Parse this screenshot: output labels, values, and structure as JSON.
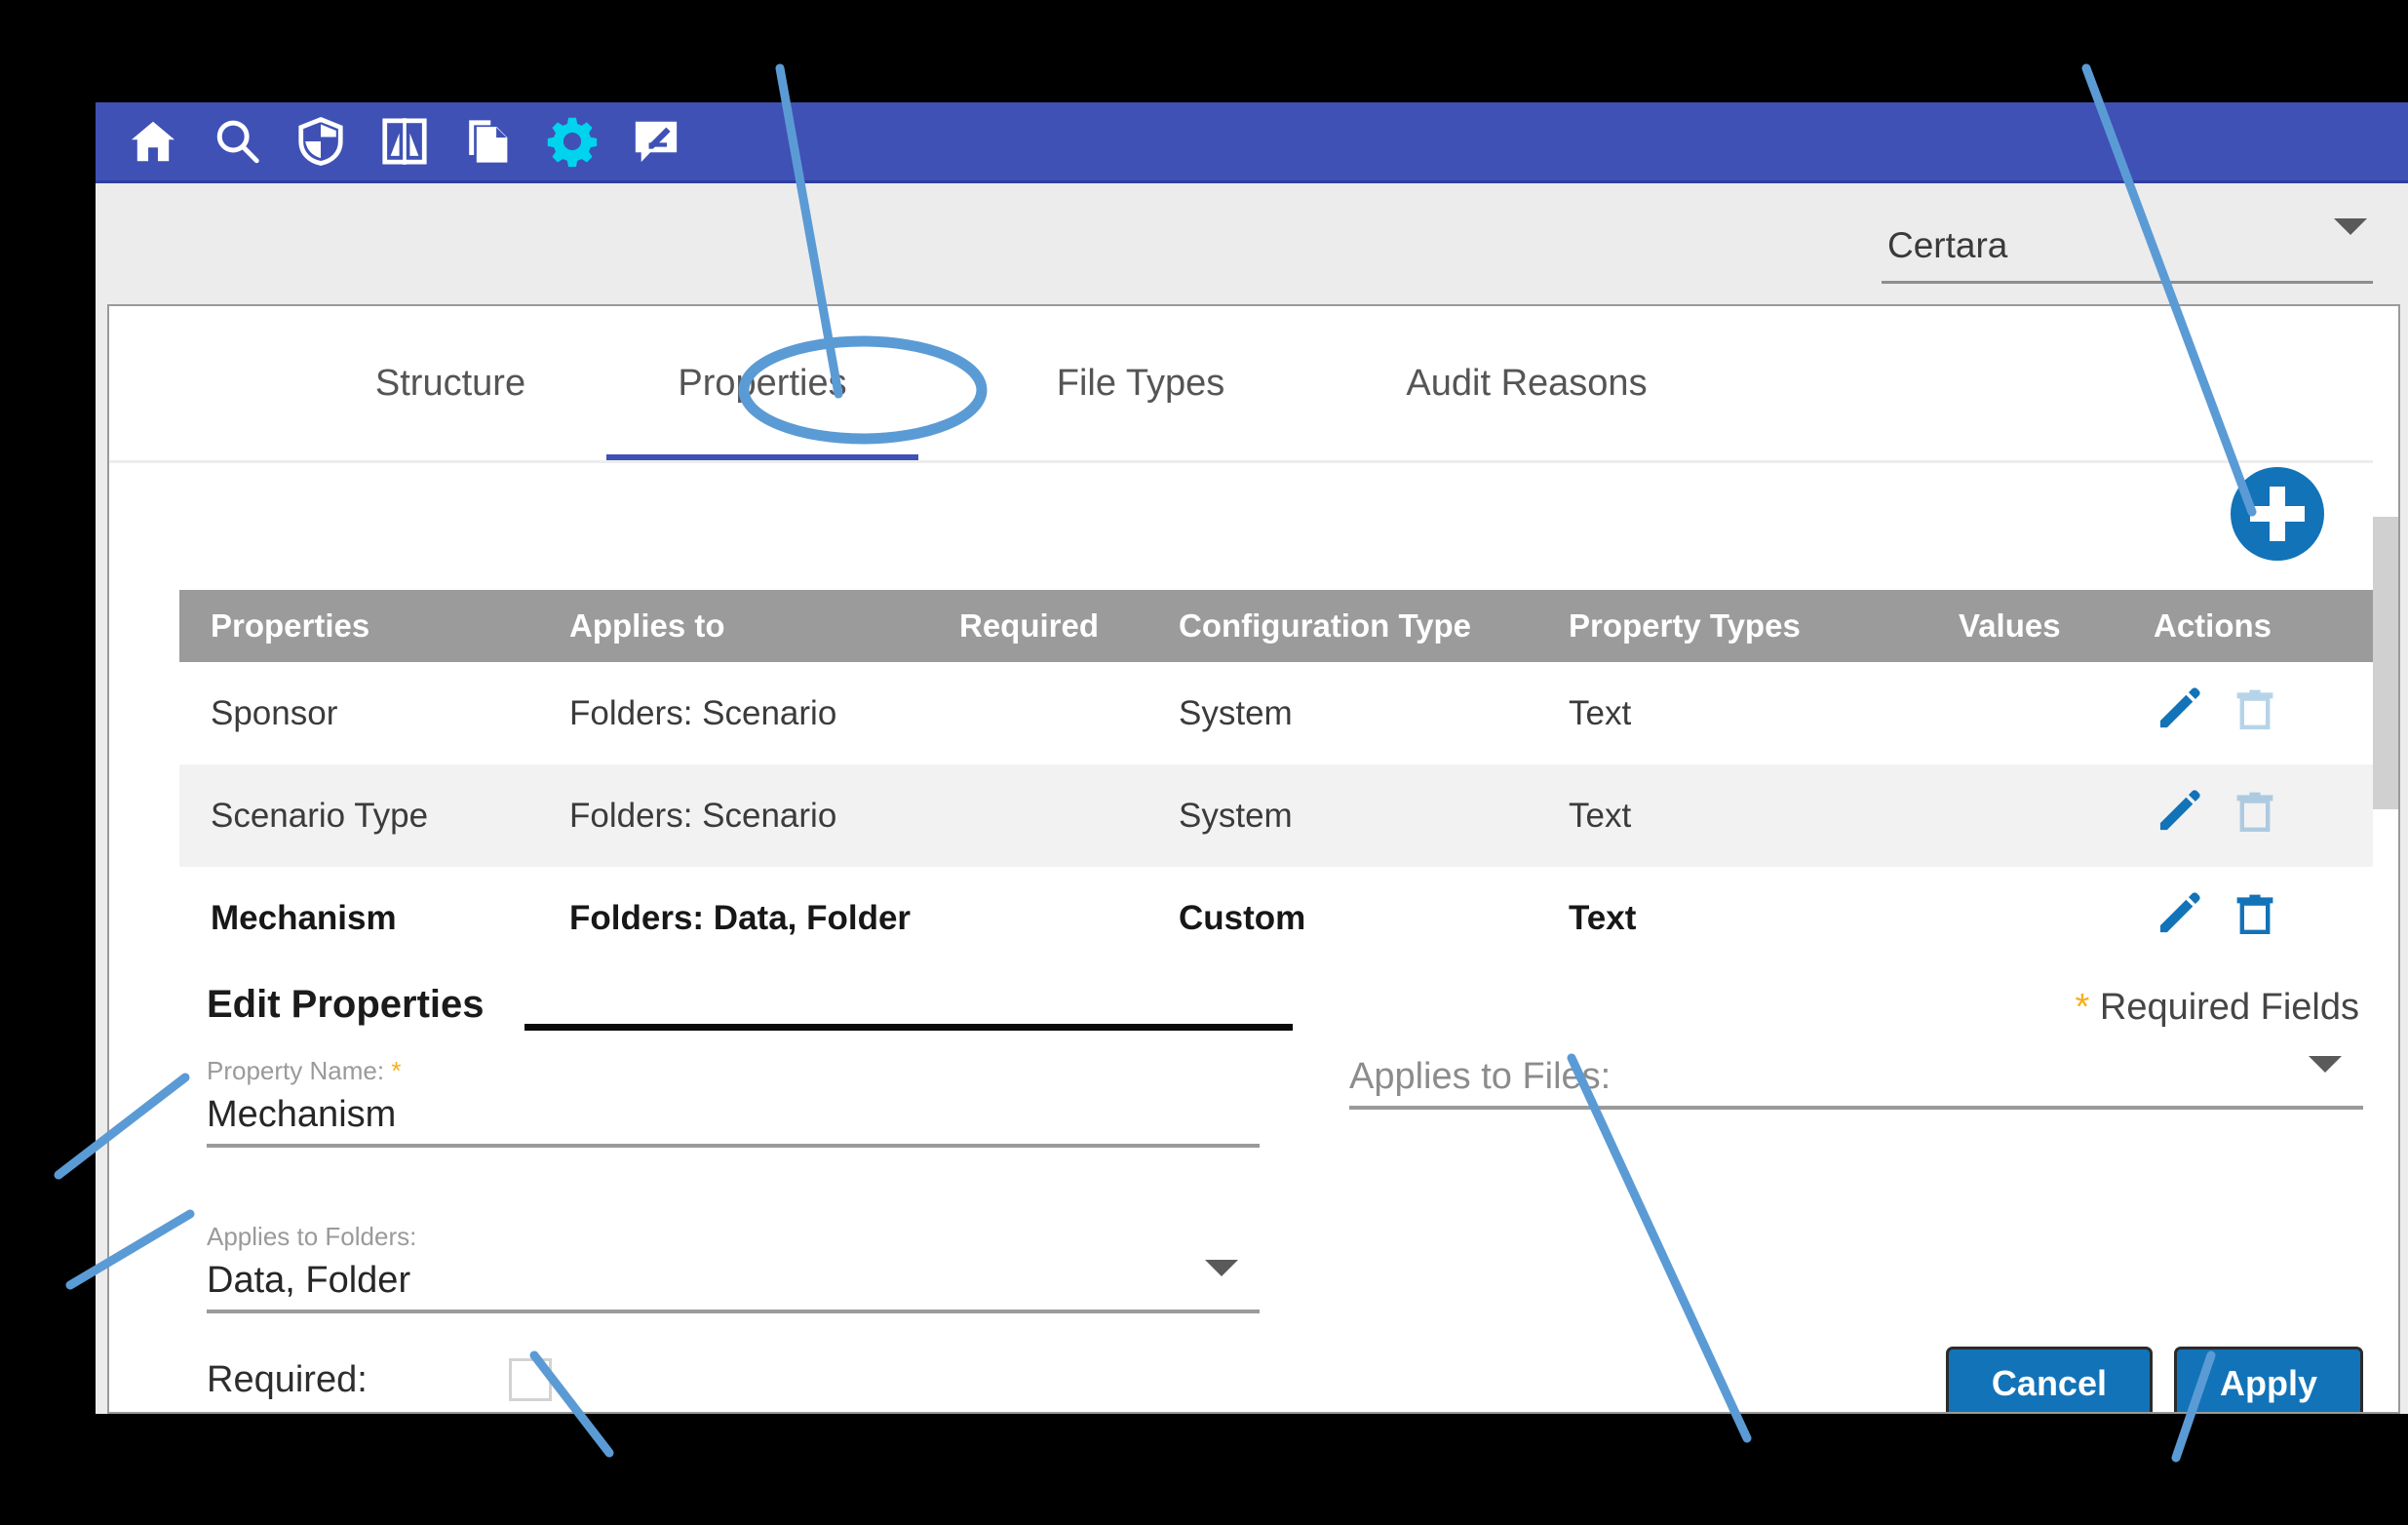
{
  "app": {
    "toolbar": {
      "icons": [
        {
          "name": "home-icon",
          "label": "Home"
        },
        {
          "name": "search-icon",
          "label": "Search"
        },
        {
          "name": "shield-icon",
          "label": "Security"
        },
        {
          "name": "compare-icon",
          "label": "Compare"
        },
        {
          "name": "copy-documents-icon",
          "label": "Documents"
        },
        {
          "name": "gear-icon",
          "label": "Settings"
        },
        {
          "name": "annotate-icon",
          "label": "Annotate"
        }
      ],
      "active_icon": "gear-icon",
      "bar_color": "#3f51b5",
      "active_icon_color": "#00d3ee"
    },
    "org_selector": {
      "value": "Certara",
      "caret": "chevron-down-icon"
    }
  },
  "tabs": [
    {
      "label": "Structure",
      "active": false
    },
    {
      "label": "Properties",
      "active": true
    },
    {
      "label": "File Types",
      "active": false
    },
    {
      "label": "Audit Reasons",
      "active": false
    }
  ],
  "add_button": {
    "icon": "plus-icon",
    "color": "#1273b8"
  },
  "table": {
    "columns": [
      "Properties",
      "Applies to",
      "Required",
      "Configuration Type",
      "Property Types",
      "Values",
      "Actions"
    ],
    "rows": [
      {
        "properties": "Sponsor",
        "applies_to": "Folders: Scenario",
        "required": "",
        "configuration_type": "System",
        "property_types": "Text",
        "values": "",
        "edit_enabled": true,
        "delete_enabled": false,
        "selected": false
      },
      {
        "properties": "Scenario Type",
        "applies_to": "Folders: Scenario",
        "required": "",
        "configuration_type": "System",
        "property_types": "Text",
        "values": "",
        "edit_enabled": true,
        "delete_enabled": false,
        "selected": false
      },
      {
        "properties": "Mechanism",
        "applies_to": "Folders: Data, Folder",
        "required": "",
        "configuration_type": "Custom",
        "property_types": "Text",
        "values": "",
        "edit_enabled": true,
        "delete_enabled": true,
        "selected": true
      }
    ]
  },
  "edit_form": {
    "title": "Edit Properties",
    "required_note_star": "*",
    "required_note_text": " Required Fields",
    "property_name": {
      "label": "Property Name:",
      "required_marker": "*",
      "value": "Mechanism"
    },
    "applies_to_folders": {
      "label": "Applies to Folders:",
      "value": "Data, Folder"
    },
    "applies_to_files": {
      "label": "Applies to Files:",
      "value": ""
    },
    "required_checkbox": {
      "label": "Required:",
      "checked": false
    },
    "buttons": {
      "cancel": "Cancel",
      "apply": "Apply"
    }
  },
  "annotations": {
    "color": "#5b9bd5",
    "callouts": [
      "gear-icon-callout",
      "properties-tab-circle",
      "add-button-callout",
      "property-name-callout",
      "applies-to-folders-callout",
      "applies-to-files-callout",
      "required-checkbox-callout",
      "apply-button-callout"
    ]
  }
}
